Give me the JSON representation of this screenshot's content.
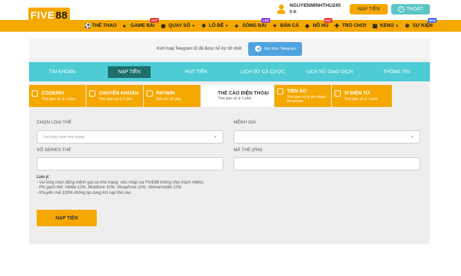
{
  "header": {
    "logo_text": "FIVE",
    "logo_num": "88",
    "username": "NGUYENMINHTHU245",
    "balance": "0 K",
    "deposit_label": "NẠP TIỀN",
    "logout_label": "THOÁT"
  },
  "nav": {
    "items": [
      {
        "label": "THỂ THAO",
        "icon": "soccer-icon"
      },
      {
        "label": "GAME BÀI",
        "icon": "cards-icon",
        "badge": "HOT"
      },
      {
        "label": "QUAY SỐ",
        "icon": "lottery-icon",
        "caret": "▼"
      },
      {
        "label": "LÔ ĐỀ",
        "icon": "lotto-icon",
        "caret": "▼"
      },
      {
        "label": "SÒNG BÀI",
        "icon": "casino-icon",
        "badge": "LIVE"
      },
      {
        "label": "BẮN CÁ",
        "icon": "fish-icon"
      },
      {
        "label": "NỔ HŨ",
        "icon": "jackpot-icon",
        "badge": "HOT"
      },
      {
        "label": "TRÒ CHƠI",
        "icon": "gamepad-icon"
      },
      {
        "label": "KENO",
        "icon": "keno-icon",
        "caret": "▼"
      },
      {
        "label": "SỰ KIỆN",
        "icon": "gift-icon",
        "badge": "NEW"
      }
    ]
  },
  "telegram": {
    "text": "Kích hoạt Telegram ID để được hỗ trợ tốt nhất",
    "button": "Xác thực Telegram"
  },
  "tabs": [
    "TÀI KHOẢN",
    "NẠP TIỀN",
    "RÚT TIỀN",
    "LỊCH SỬ CÁ CƯỢC",
    "LỊCH SỬ GIAO DỊCH",
    "THÔNG TIN"
  ],
  "subtabs": [
    {
      "title": "CODEPAY",
      "sub": "Thời gian xử lý 1 phút"
    },
    {
      "title": "CHUYỂN KHOẢN",
      "sub": "Thời gian xử lý 5 phút"
    },
    {
      "title": "PAYWIN",
      "sub": "Siêu tốc 30 giây"
    },
    {
      "title": "THẺ CÀO ĐIỆN THOẠI",
      "sub": "Thời gian xử lý 1 phút"
    },
    {
      "title": "TIỀN ẢO",
      "sub": "Thời gian xử lý phụ thuộc Blockchain"
    },
    {
      "title": "VÍ ĐIỆN TỬ",
      "sub": "Thời gian xử lý 1 phút"
    }
  ],
  "form": {
    "card_type_label": "CHỌN LOẠI THẺ",
    "card_type_placeholder": "Vui lòng chọn nhà mạng",
    "denomination_label": "MỆNH GIÁ",
    "denomination_value": "",
    "serial_label": "SỐ SERIES THẺ",
    "serial_value": "",
    "pin_label": "MÃ THẺ (PIN)",
    "pin_value": ""
  },
  "notes": {
    "heading": "Lưu ý:",
    "lines": [
      "- Vui lòng chọn đúng mệnh giá và nhà mạng, nếu nhập sai FIVE88 không chịu trách nhiệm.",
      "- Phí gạch thẻ: Viettel 12%, Mobifone 10%, Vinaphone 11%, Vietnamobile 12%.",
      "- Khuyến mãi 100% không áp dụng khi nạp thẻ cào."
    ]
  },
  "submit_label": "NẠP TIỀN",
  "colors": {
    "brand": "#f5a800",
    "teal": "#4dccd4",
    "tab_active": "#1f6f6f",
    "telegram": "#4fa3e0"
  }
}
